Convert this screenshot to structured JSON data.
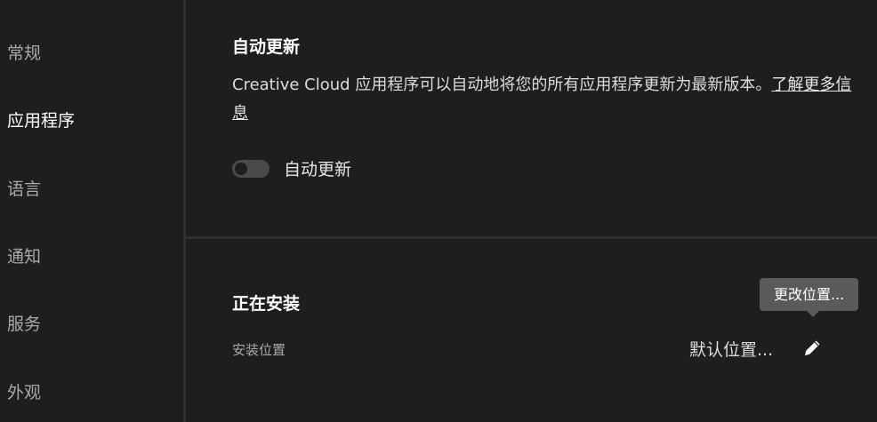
{
  "sidebar": {
    "items": [
      {
        "label": "常规",
        "active": false
      },
      {
        "label": "应用程序",
        "active": true
      },
      {
        "label": "语言",
        "active": false
      },
      {
        "label": "通知",
        "active": false
      },
      {
        "label": "服务",
        "active": false
      },
      {
        "label": "外观",
        "active": false
      }
    ]
  },
  "auto_update": {
    "title": "自动更新",
    "description": "Creative Cloud 应用程序可以自动地将您的所有应用程序更新为最新版本。",
    "learn_more": "了解更多信息",
    "toggle_label": "自动更新",
    "toggle_on": false
  },
  "installing": {
    "title": "正在安装",
    "location_label": "安装位置",
    "location_value": "默认位置...",
    "edit_icon": "pencil-icon",
    "tooltip": "更改位置..."
  },
  "colors": {
    "background": "#1e1e1e",
    "divider": "#2f2f2f",
    "tooltip": "#5a5a5a"
  }
}
